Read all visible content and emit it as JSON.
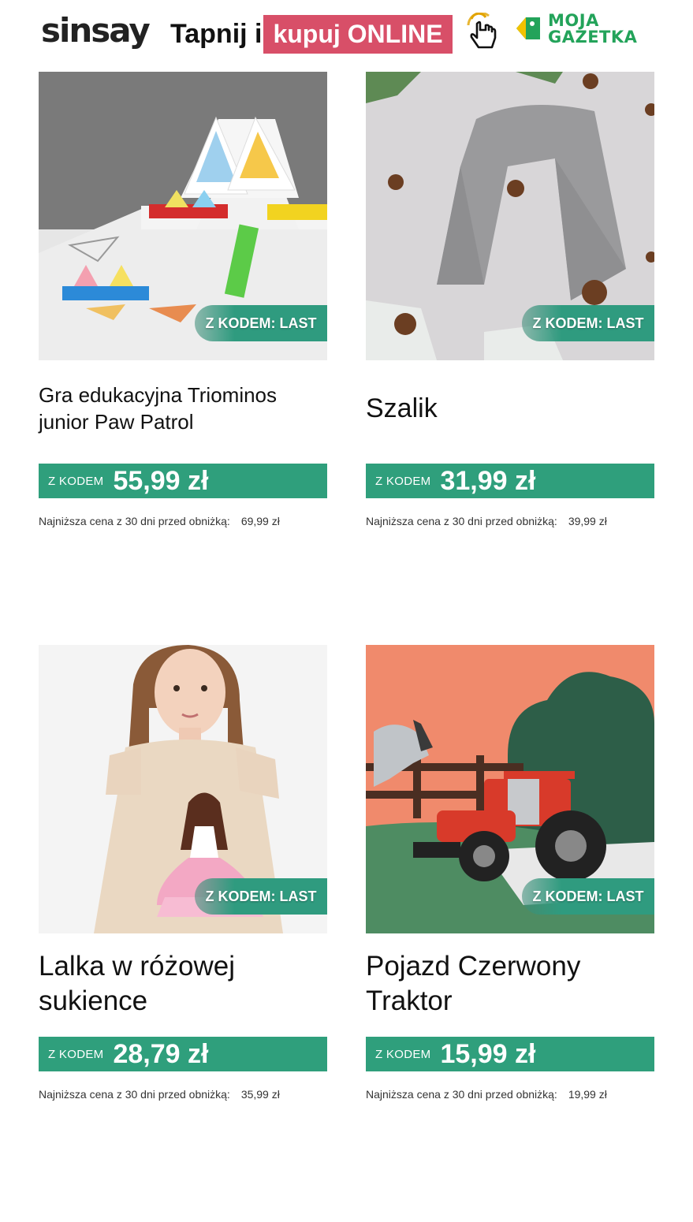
{
  "header": {
    "logo": "sinsay",
    "tap_text": "Tapnij i",
    "buy_text": "kupuj ONLINE",
    "pointer_icon": "hand-pointer-icon",
    "brand_line1": "MOJA",
    "brand_line2": "GAZETKA",
    "brand_icon": "price-tag-icon"
  },
  "colors": {
    "accent_pink": "#d84f68",
    "price_green": "#2f9f7c",
    "brand_green": "#23a35a"
  },
  "products": [
    {
      "badge": "Z KODEM: LAST",
      "title": "Gra edukacyjna Triominos junior Paw Patrol",
      "price_prefix": "Z KODEM",
      "price": "55,99 zł",
      "lowest_label": "Najniższa cena z 30 dni przed obniżką:",
      "lowest_value": "69,99 zł"
    },
    {
      "badge": "Z KODEM: LAST",
      "title": "Szalik",
      "price_prefix": "Z KODEM",
      "price": "31,99 zł",
      "lowest_label": "Najniższa cena z 30 dni przed obniżką:",
      "lowest_value": "39,99 zł"
    },
    {
      "badge": "Z KODEM: LAST",
      "title": "Lalka w różowej sukience",
      "price_prefix": "Z KODEM",
      "price": "28,79 zł",
      "lowest_label": "Najniższa cena z 30 dni przed obniżką:",
      "lowest_value": "35,99 zł"
    },
    {
      "badge": "Z KODEM: LAST",
      "title": "Pojazd Czerwony Traktor",
      "price_prefix": "Z KODEM",
      "price": "15,99 zł",
      "lowest_label": "Najniższa cena z 30 dni przed obniżką:",
      "lowest_value": "19,99 zł"
    }
  ]
}
